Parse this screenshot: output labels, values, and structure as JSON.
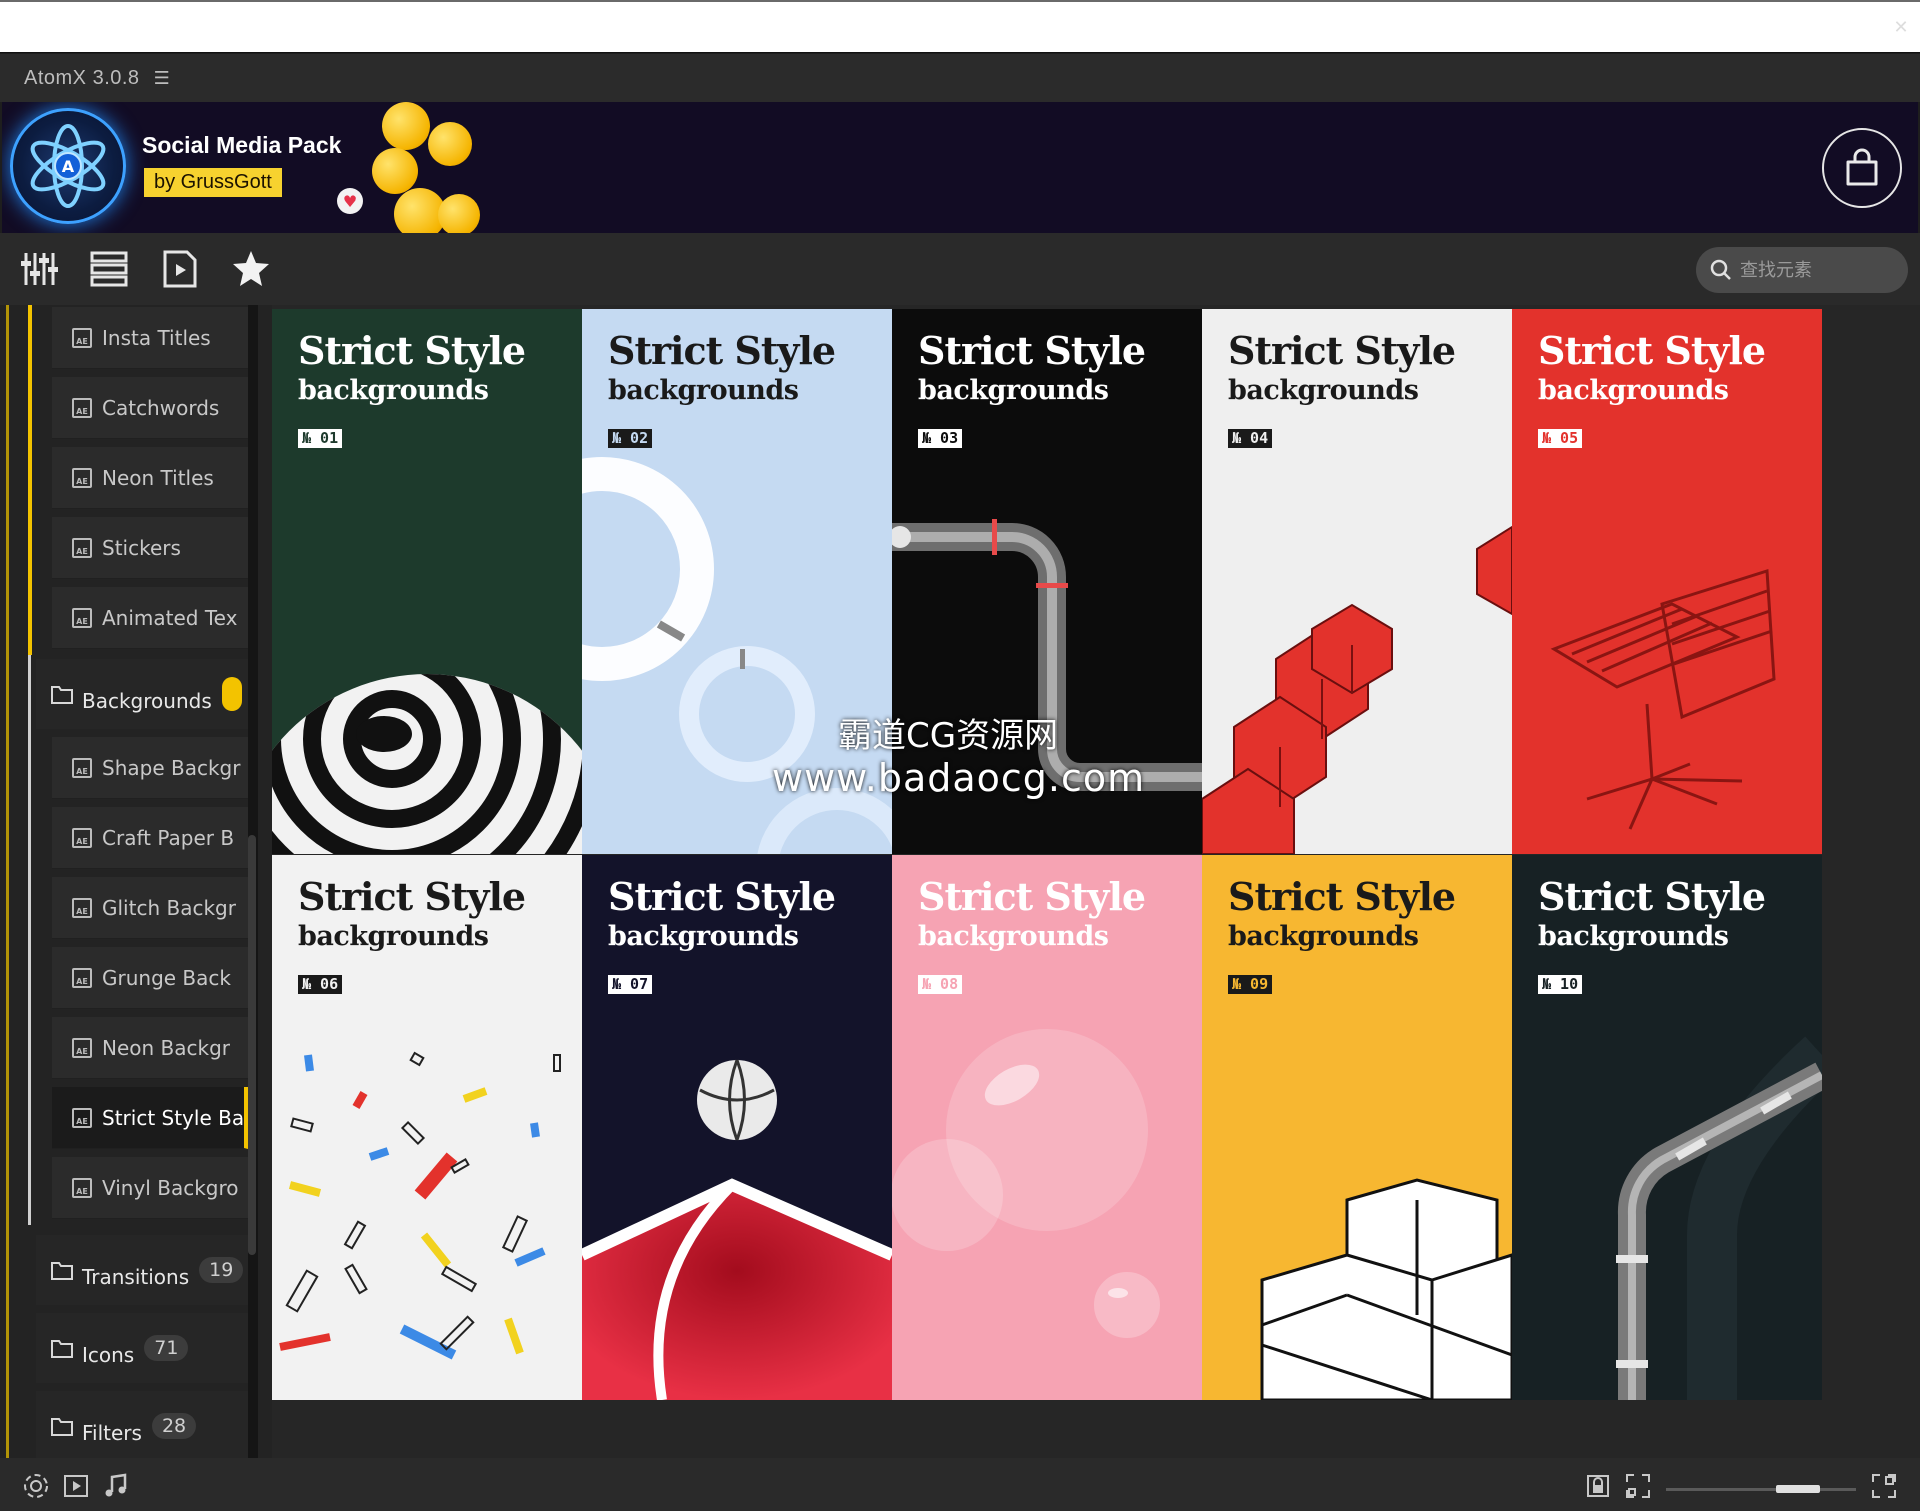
{
  "app": {
    "title": "AtomX 3.0.8",
    "menu_icon": "☰",
    "close_glyph": "✕"
  },
  "banner": {
    "pack_title": "Social Media Pack",
    "author": "by GrussGott",
    "logo_icon": "atom-logo-icon",
    "store_icon": "shopping-bag-icon"
  },
  "toolbar": {
    "icons": [
      "sliders-icon",
      "list-icon",
      "play-file-icon",
      "star-icon"
    ],
    "search": {
      "placeholder": "查找元素",
      "value": ""
    }
  },
  "sidebar": {
    "top_items": [
      {
        "label": "Insta Titles"
      },
      {
        "label": "Catchwords"
      },
      {
        "label": "Neon Titles"
      },
      {
        "label": "Stickers"
      },
      {
        "label": "Animated Tex"
      }
    ],
    "backgrounds": {
      "label": "Backgrounds"
    },
    "bg_items": [
      {
        "label": "Shape Backgr"
      },
      {
        "label": "Craft Paper B"
      },
      {
        "label": "Glitch Backgr"
      },
      {
        "label": "Grunge Back"
      },
      {
        "label": "Neon Backgr"
      },
      {
        "label": "Strict Style Ba",
        "active": true
      },
      {
        "label": "Vinyl Backgro"
      }
    ],
    "categories": [
      {
        "label": "Transitions",
        "count": "19"
      },
      {
        "label": "Icons",
        "count": "71"
      },
      {
        "label": "Filters",
        "count": "28"
      }
    ],
    "ae_glyph": "AE"
  },
  "grid": {
    "title": "Strict Style",
    "subtitle": "backgrounds",
    "cards": [
      {
        "num": "№ 01",
        "bg": "#1d3a2c",
        "fg": "#ffffff",
        "badge_bg": "#ffffff",
        "badge_fg": "#1d3a2c"
      },
      {
        "num": "№ 02",
        "bg": "#c5daf2",
        "fg": "#1a1a1a",
        "badge_bg": "#1a1a1a",
        "badge_fg": "#c5daf2"
      },
      {
        "num": "№ 03",
        "bg": "#0c0c0c",
        "fg": "#ffffff",
        "badge_bg": "#ffffff",
        "badge_fg": "#0c0c0c"
      },
      {
        "num": "№ 04",
        "bg": "#efefef",
        "fg": "#1a1a1a",
        "badge_bg": "#1a1a1a",
        "badge_fg": "#efefef"
      },
      {
        "num": "№ 05",
        "bg": "#e3322c",
        "fg": "#ffffff",
        "badge_bg": "#ffffff",
        "badge_fg": "#e3322c"
      },
      {
        "num": "№ 06",
        "bg": "#f2f2f2",
        "fg": "#1a1a1a",
        "badge_bg": "#1a1a1a",
        "badge_fg": "#f2f2f2"
      },
      {
        "num": "№ 07",
        "bg": "#13132a",
        "fg": "#ffffff",
        "badge_bg": "#ffffff",
        "badge_fg": "#13132a"
      },
      {
        "num": "№ 08",
        "bg": "#f6a3b3",
        "fg": "#ffffff",
        "badge_bg": "#ffffff",
        "badge_fg": "#f6a3b3"
      },
      {
        "num": "№ 09",
        "bg": "#f7b731",
        "fg": "#1a1a1a",
        "badge_bg": "#1a1a1a",
        "badge_fg": "#f7b731"
      },
      {
        "num": "№ 10",
        "bg": "#172124",
        "fg": "#ffffff",
        "badge_bg": "#ffffff",
        "badge_fg": "#172124"
      }
    ]
  },
  "watermark": {
    "line1": "霸道CG资源网",
    "line2": "www.badaocg.com"
  },
  "status_bar": {
    "left_icons": [
      "orbit-icon",
      "video-icon",
      "music-note-icon"
    ],
    "right_icons": [
      "lock-icon",
      "fit-icon",
      "expand-icon"
    ],
    "zoom_level": 0.75
  },
  "colors": {
    "accent": "#f3c300",
    "banner_bg": "#120c24",
    "panel_bg": "#262626"
  }
}
